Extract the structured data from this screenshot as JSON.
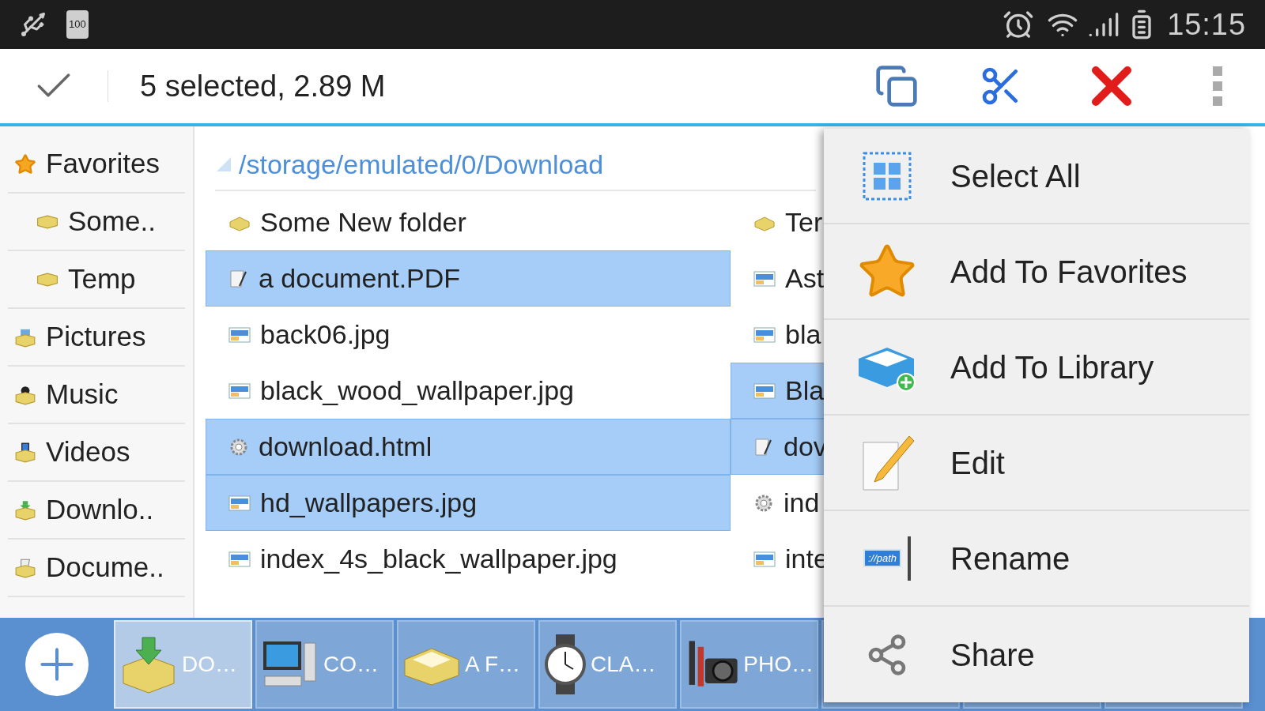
{
  "status_bar": {
    "battery_label": "100",
    "time": "15:15"
  },
  "action_bar": {
    "title": "5 selected, 2.89 M"
  },
  "sidebar": {
    "items": [
      {
        "label": "Favorites",
        "kind": "star",
        "children": [
          {
            "label": "Some..",
            "kind": "folder"
          },
          {
            "label": "Temp",
            "kind": "folder"
          }
        ]
      },
      {
        "label": "Pictures",
        "kind": "pictures"
      },
      {
        "label": "Music",
        "kind": "music"
      },
      {
        "label": "Videos",
        "kind": "videos"
      },
      {
        "label": "Downlo..",
        "kind": "download"
      },
      {
        "label": "Docume..",
        "kind": "documents"
      }
    ]
  },
  "path": "/storage/emulated/0/Download",
  "files": [
    {
      "name": "Some New folder",
      "kind": "folder",
      "selected": false
    },
    {
      "name": "Ter",
      "kind": "folder",
      "selected": false
    },
    {
      "name": "a document.PDF",
      "kind": "document",
      "selected": true
    },
    {
      "name": "Ast",
      "kind": "image",
      "selected": false
    },
    {
      "name": "back06.jpg",
      "kind": "image",
      "selected": false
    },
    {
      "name": "bla",
      "kind": "image",
      "selected": false
    },
    {
      "name": "black_wood_wallpaper.jpg",
      "kind": "image",
      "selected": false
    },
    {
      "name": "Bla",
      "kind": "image",
      "selected": true
    },
    {
      "name": "download.html",
      "kind": "web",
      "selected": true
    },
    {
      "name": "dov",
      "kind": "document",
      "selected": true
    },
    {
      "name": "hd_wallpapers.jpg",
      "kind": "image",
      "selected": true
    },
    {
      "name": "ind",
      "kind": "web",
      "selected": false
    },
    {
      "name": "index_4s_black_wallpaper.jpg",
      "kind": "image",
      "selected": false
    },
    {
      "name": "inte",
      "kind": "image",
      "selected": false
    }
  ],
  "menu": [
    {
      "label": "Select All",
      "kind": "select"
    },
    {
      "label": "Add To Favorites",
      "kind": "star"
    },
    {
      "label": "Add To Library",
      "kind": "library"
    },
    {
      "label": "Edit",
      "kind": "edit"
    },
    {
      "label": "Rename",
      "kind": "rename",
      "badge": "://path"
    },
    {
      "label": "Share",
      "kind": "share"
    }
  ],
  "tabs": [
    {
      "label": "DO…",
      "kind": "download",
      "selected": true
    },
    {
      "label": "CO…",
      "kind": "computer",
      "selected": false
    },
    {
      "label": "A F…",
      "kind": "folder",
      "selected": false
    },
    {
      "label": "CLA…",
      "kind": "clock",
      "selected": false
    },
    {
      "label": "PHO…",
      "kind": "camera",
      "selected": false
    }
  ]
}
